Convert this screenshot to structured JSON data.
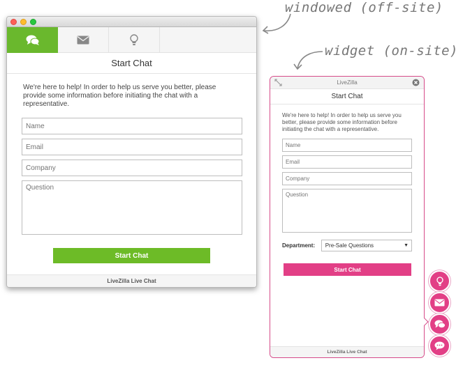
{
  "annotations": {
    "windowed": "windowed (off-site)",
    "widget": "widget (on-site)"
  },
  "window": {
    "tabs": [
      {
        "icon": "chat-bubbles-icon",
        "active": true
      },
      {
        "icon": "envelope-icon",
        "active": false
      },
      {
        "icon": "lightbulb-icon",
        "active": false
      }
    ],
    "header": "Start Chat",
    "intro": "We're here to help! In order to help us serve you better, please provide some information before initiating the chat with a representative.",
    "fields": {
      "name": "Name",
      "email": "Email",
      "company": "Company",
      "question": "Question"
    },
    "button": "Start Chat",
    "footer": "LiveZilla Live Chat"
  },
  "widget": {
    "title": "LiveZilla",
    "header": "Start Chat",
    "intro": "We're here to help! In order to help us serve you better, please provide some information before initiating the chat with a representative.",
    "fields": {
      "name": "Name",
      "email": "Email",
      "company": "Company",
      "question": "Question"
    },
    "department_label": "Department:",
    "department_value": "Pre-Sale Questions",
    "button": "Start Chat",
    "footer": "LiveZilla Live Chat"
  },
  "floating_buttons": [
    "lightbulb-icon",
    "envelope-icon",
    "chat-bubbles-icon",
    "speech-bubble-icon"
  ],
  "colors": {
    "green": "#6dbb27",
    "pink": "#e23f86",
    "annotation": "#777777"
  }
}
